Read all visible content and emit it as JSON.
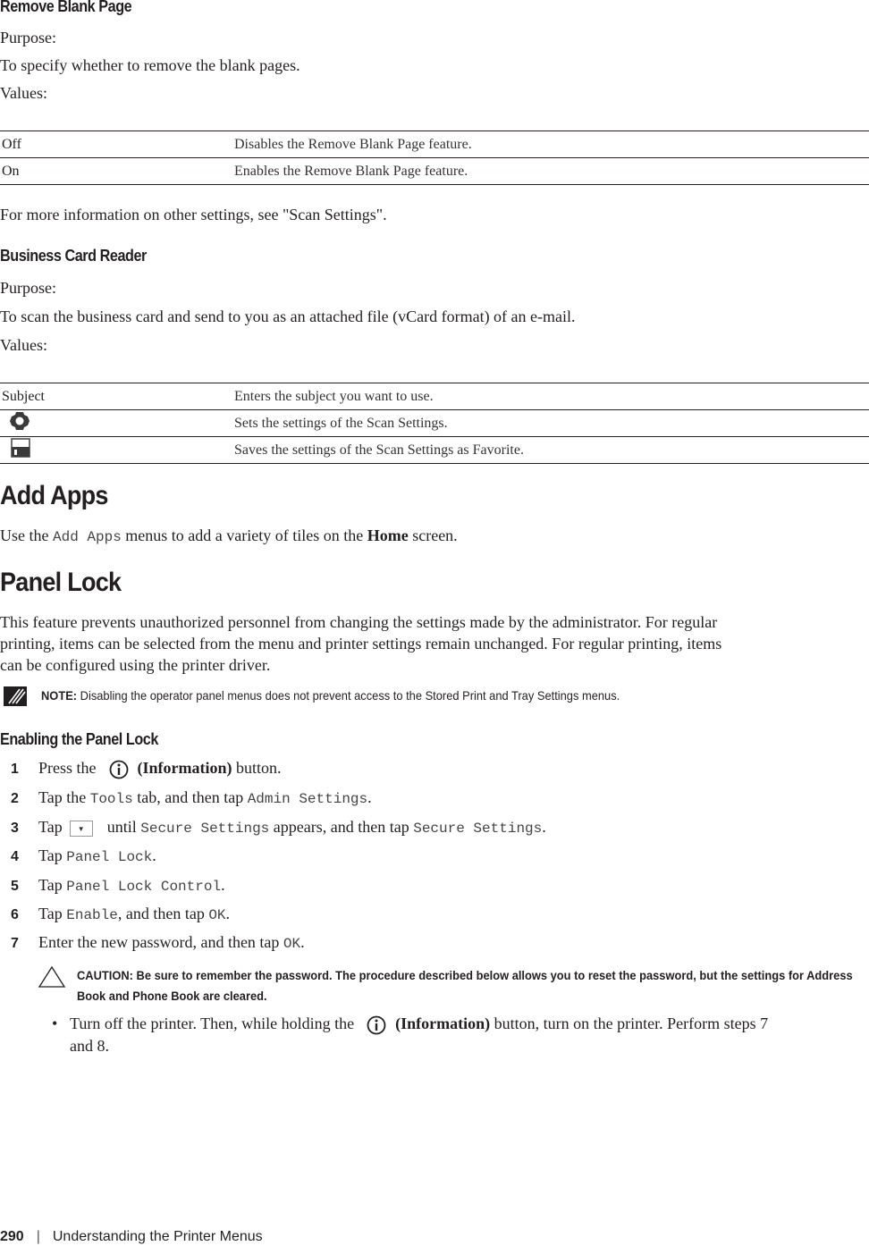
{
  "remove_blank": {
    "title": "Remove Blank Page",
    "purpose_label": "Purpose:",
    "purpose": "To specify whether to remove the blank pages.",
    "values_label": "Values:",
    "rows": [
      {
        "key": "Off",
        "desc": "Disables the Remove Blank Page feature."
      },
      {
        "key": "On",
        "desc": "Enables the Remove Blank Page feature."
      }
    ],
    "more_info": "For more information on other settings, see \"Scan Settings\"."
  },
  "business_card": {
    "title": "Business Card Reader",
    "purpose_label": "Purpose:",
    "purpose": "To scan the business card and send to you as an attached file (vCard format) of an e-mail.",
    "values_label": "Values:",
    "rows": [
      {
        "key": "Subject",
        "icon": null,
        "desc": "Enters the subject you want to use."
      },
      {
        "key": "",
        "icon": "gear-icon",
        "desc": "Sets the settings of the Scan Settings."
      },
      {
        "key": "",
        "icon": "save-icon",
        "desc": "Saves the settings of the Scan Settings as Favorite."
      }
    ]
  },
  "add_apps": {
    "title": "Add Apps",
    "text_pre": "Use the ",
    "menu": "Add Apps",
    "text_mid": " menus to add a variety of tiles on the ",
    "home": "Home",
    "text_post": " screen."
  },
  "panel_lock": {
    "title": "Panel Lock",
    "para_lines": [
      "This feature prevents unauthorized personnel from changing the settings made by the administrator. For regular",
      "printing, items can be selected from the menu and printer settings remain unchanged. For regular printing, items",
      "can be configured using the printer driver."
    ],
    "note_label": "NOTE:",
    "note_text": " Disabling the operator panel menus does not prevent access to the Stored Print and Tray Settings menus."
  },
  "enabling": {
    "title": "Enabling the Panel Lock",
    "steps": [
      {
        "num": "1",
        "a": "Press the",
        "icon": "info-icon",
        "b": "(Information)",
        "c": " button."
      },
      {
        "num": "2",
        "a": "Tap the ",
        "m1": "Tools",
        "b": " tab, and then tap ",
        "m2": "Admin Settings",
        "c": "."
      },
      {
        "num": "3",
        "a": "Tap",
        "icon": "dropdown-arrow",
        "b": "until ",
        "m1": "Secure Settings",
        "c": " appears, and then tap ",
        "m2": "Secure Settings",
        "d": "."
      },
      {
        "num": "4",
        "a": "Tap ",
        "m1": "Panel Lock",
        "c": "."
      },
      {
        "num": "5",
        "a": "Tap ",
        "m1": "Panel Lock Control",
        "c": "."
      },
      {
        "num": "6",
        "a": "Tap ",
        "m1": "Enable",
        "b": ", and then tap ",
        "m2": "OK",
        "c": "."
      },
      {
        "num": "7",
        "a": "Enter the new password, and then tap ",
        "m1": "OK",
        "c": "."
      }
    ],
    "caution_label": "CAUTION:",
    "caution_text": " Be sure to remember the password. The procedure described below allows you to reset the password, but the settings for Address Book and Phone Book are cleared.",
    "bullet": {
      "a": "Turn off the printer. Then, while holding the",
      "b": "(Information)",
      "c": " button, turn on the printer. Perform steps 7",
      "d": "and 8."
    }
  },
  "footer": {
    "page": "290",
    "separator": "|",
    "chapter": "Understanding the Printer Menus"
  }
}
